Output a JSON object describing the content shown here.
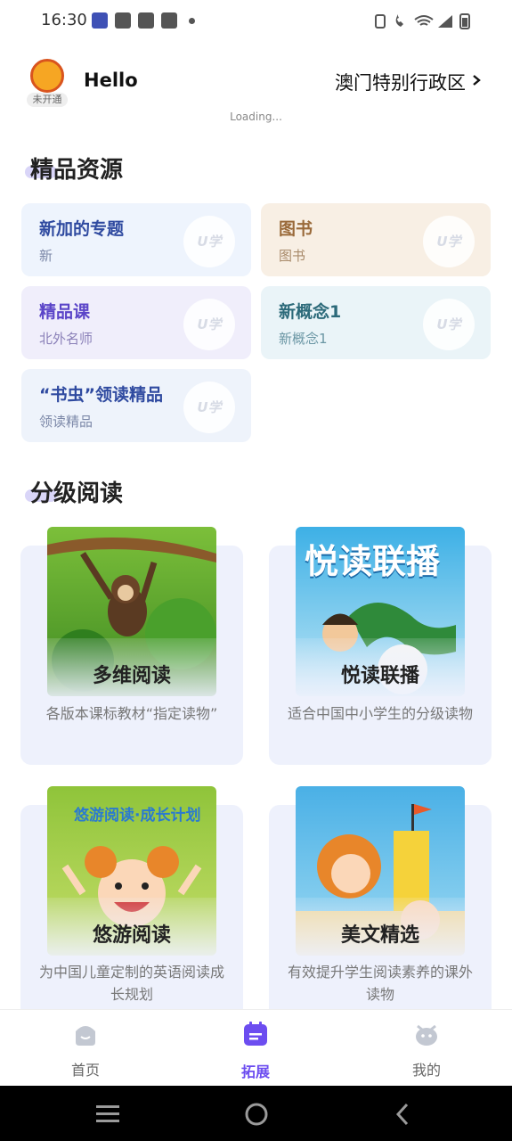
{
  "status_bar": {
    "time": "16:30"
  },
  "header": {
    "avatar_label": "未开通",
    "greeting": "Hello",
    "region": "澳门特别行政区"
  },
  "loading_text": "Loading...",
  "premium": {
    "title": "精品资源",
    "logo_text": "U学",
    "cards": [
      {
        "title": "新加的专题",
        "subtitle": "新"
      },
      {
        "title": "图书",
        "subtitle": "图书"
      },
      {
        "title": "精品课",
        "subtitle": "北外名师"
      },
      {
        "title": "新概念1",
        "subtitle": "新概念1"
      },
      {
        "title": "“书虫”领读精品",
        "subtitle": "领读精品"
      }
    ]
  },
  "graded": {
    "title": "分级阅读",
    "items": [
      {
        "name": "多维阅读",
        "desc": "各版本课标教材“指定读物”"
      },
      {
        "name": "悦读联播",
        "desc": "适合中国中小学生的分级读物",
        "cover_text": "悦读联播"
      },
      {
        "name": "悠游阅读",
        "desc": "为中国儿童定制的英语阅读成长规划",
        "cover_text": "悠游阅读·成长计划"
      },
      {
        "name": "美文精选",
        "desc": "有效提升学生阅读素养的课外读物"
      }
    ]
  },
  "bottom_nav": {
    "items": [
      {
        "label": "首页",
        "icon": "home-icon",
        "active": false
      },
      {
        "label": "拓展",
        "icon": "expand-icon",
        "active": true
      },
      {
        "label": "我的",
        "icon": "profile-icon",
        "active": false
      }
    ],
    "active_color": "#6c4df0"
  },
  "colors": {
    "accent": "#6c4df0"
  }
}
